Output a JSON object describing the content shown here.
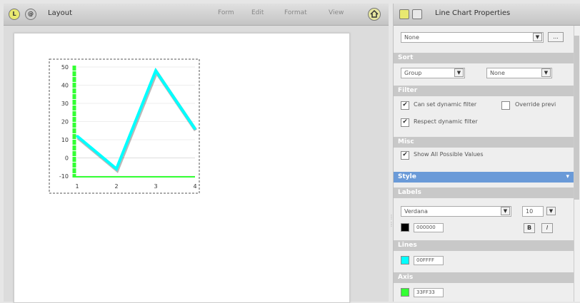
{
  "layout_panel": {
    "title": "Layout",
    "icon_l": "L",
    "icon_circle": "@",
    "menus": [
      "Form",
      "Edit",
      "Format",
      "View"
    ],
    "home_icon": "home-icon"
  },
  "chart_data": {
    "type": "line",
    "x": [
      1,
      2,
      3,
      4
    ],
    "series": [
      {
        "values": [
          12,
          -6,
          48,
          16
        ]
      }
    ],
    "xlim": [
      1,
      4
    ],
    "ylim": [
      -10,
      50
    ],
    "yticks": [
      50,
      40,
      30,
      20,
      10,
      0,
      -10
    ],
    "xticks": [
      1,
      2,
      3,
      4
    ],
    "line_color": "#00FFFF",
    "axis_color": "#33FF33",
    "grid": true
  },
  "properties_panel": {
    "title": "Line Chart Properties",
    "top_select": "None",
    "top_button": "...",
    "sort": {
      "header": "Sort",
      "group": "Group",
      "order": "None"
    },
    "filter": {
      "header": "Filter",
      "can_set": "Can set dynamic filter",
      "can_set_checked": true,
      "override": "Override previ",
      "override_checked": false,
      "respect": "Respect dynamic filter",
      "respect_checked": true
    },
    "misc": {
      "header": "Misc",
      "show_all": "Show All Possible Values",
      "show_all_checked": true
    },
    "style_header": "Style",
    "labels": {
      "header": "Labels",
      "font": "Verdana",
      "size": "10",
      "color_hex": "000000",
      "color": "#000000",
      "bold": "B",
      "italic": "I"
    },
    "lines": {
      "header": "Lines",
      "color_hex": "00FFFF",
      "color": "#00FFFF"
    },
    "axis": {
      "header": "Axis",
      "color_hex": "33FF33",
      "color": "#33FF33"
    }
  }
}
